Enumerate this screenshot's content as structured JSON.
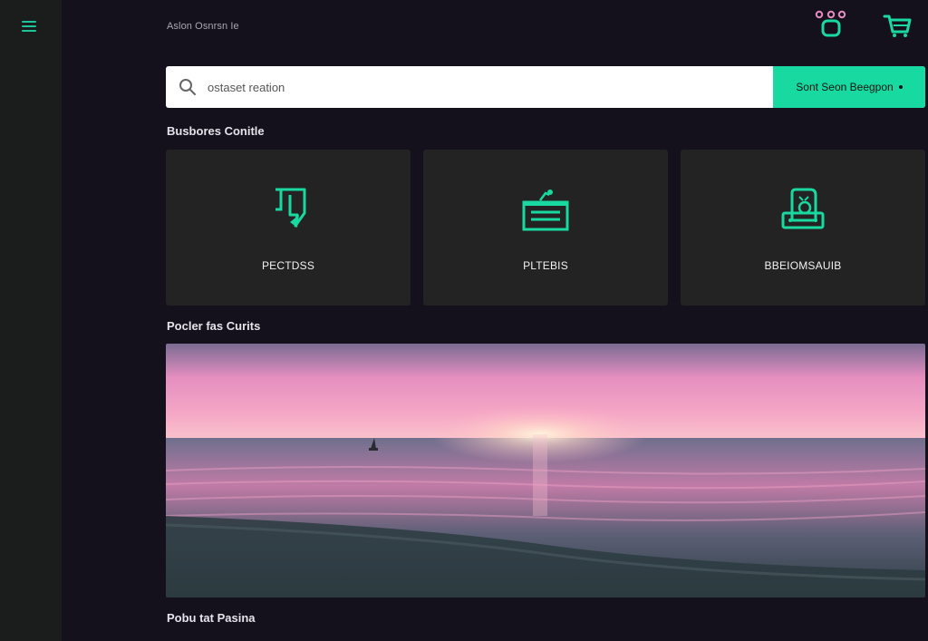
{
  "header": {
    "breadcrumb": "Aslon Osnrsn Ie"
  },
  "icons": {
    "menu": "menu-icon",
    "account": "robot-account-icon",
    "cart": "cart-icon",
    "search": "search-icon"
  },
  "search": {
    "placeholder": "ostaset reation",
    "button_label": "Sont Seon Beegpon"
  },
  "sections": {
    "categories_title": "Busbores Conitle",
    "featured_title": "Pocler fas Curits",
    "footer_title": "Pobu tat Pasina"
  },
  "cards": [
    {
      "label": "PECTDSS",
      "icon": "document-icon"
    },
    {
      "label": "PLTEBIS",
      "icon": "clipboard-icon"
    },
    {
      "label": "BBEIOMSAUIB",
      "icon": "profile-badge-icon"
    }
  ],
  "colors": {
    "accent": "#18d9a0",
    "background": "#14101c",
    "sidebar": "#1b1d1d",
    "card": "#222322"
  }
}
